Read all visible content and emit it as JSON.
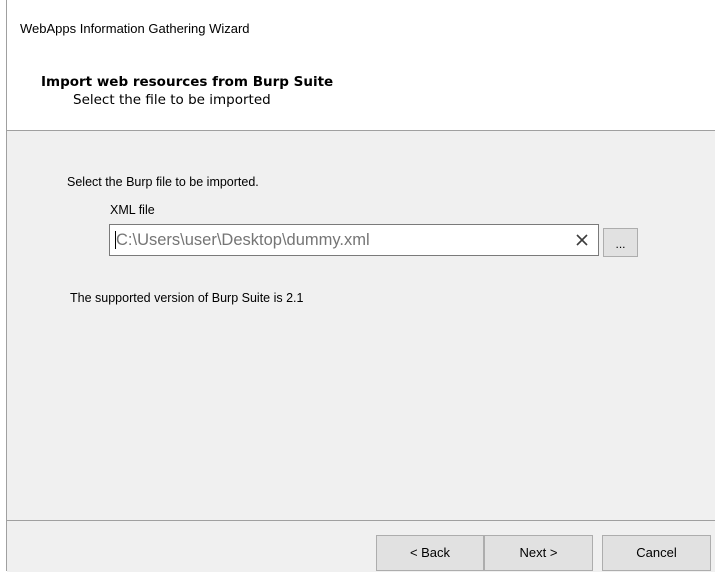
{
  "window": {
    "title": "WebApps Information Gathering Wizard"
  },
  "header": {
    "heading": "Import web resources from Burp Suite",
    "subheading": "Select the file to be imported"
  },
  "content": {
    "instruction": "Select the Burp file to be imported.",
    "xml_field": {
      "label": "XML file",
      "placeholder": "C:\\Users\\user\\Desktop\\dummy.xml",
      "value": ""
    },
    "browse_label": "...",
    "clear_icon": "close-icon",
    "version_note": "The supported version of Burp Suite is 2.1"
  },
  "footer": {
    "back_label": "< Back",
    "next_label": "Next >",
    "cancel_label": "Cancel"
  }
}
